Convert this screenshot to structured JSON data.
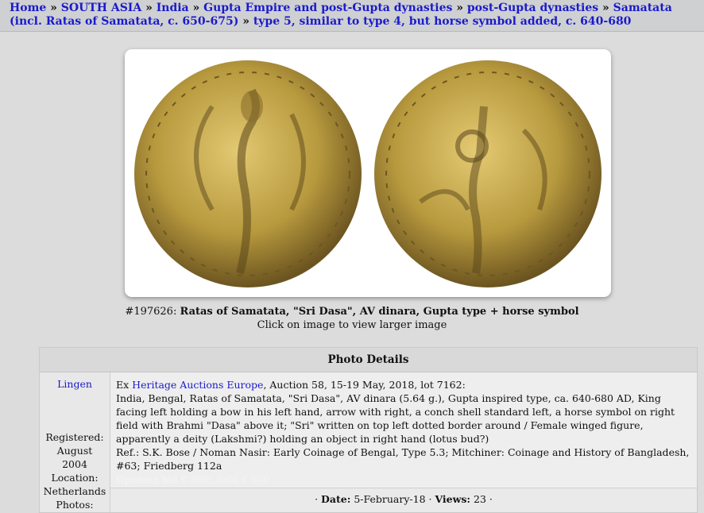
{
  "breadcrumb": {
    "items": [
      "Home",
      "SOUTH ASIA",
      "India",
      "Gupta Empire and post-Gupta dynasties",
      "post-Gupta dynasties",
      "Samatata (incl. Ratas of Samatata, c. 650-675)",
      "type 5, similar to type 4, but horse symbol added, c. 640-680"
    ],
    "separator": "»"
  },
  "photo": {
    "id_label": "#197626:",
    "title": "Ratas of Samatata, \"Sri Dasa\", AV dinara, Gupta type + horse symbol",
    "click_hint": "Click on image to view larger image"
  },
  "details": {
    "header": "Photo Details",
    "user": "Lingen",
    "registered_label": "Registered:",
    "registered_value_1": "August",
    "registered_value_2": "2004",
    "location_label": "Location:",
    "location_value": "Netherlands",
    "photos_label": "Photos:",
    "ex_prefix": "Ex",
    "ex_link": "Heritage Auctions Europe",
    "ex_suffix": ", Auction 58, 15-19 May, 2018, lot 7162:",
    "description": "India, Bengal, Ratas of Samatata, \"Sri Dasa\", AV dinara (5.64 g.), Gupta inspired type, ca. 640-680 AD, King facing left holding a bow in his left hand, arrow with right, a conch shell standard left, a horse symbol on right field with Brahmi \"Dasa\" above it; \"Sri\" written on top left dotted border around / Female winged figure, apparently a deity (Lakshmi?) holding an object in right hand (lotus bud?)",
    "references": "Ref.: S.K. Bose / Noman Nasir: Early Coinage of Bengal, Type 5.3; Mitchiner: Coinage and History of Bangladesh, #63; Friedberg 112a",
    "bid_text": "Opening bid € 300; Sold € 600",
    "date_label": "Date:",
    "date_value": "5-February-18",
    "views_label": "Views:",
    "views_value": "23"
  },
  "colors": {
    "link": "#1a1acc",
    "page_background": "#dcdcdc",
    "coin_gold": "#b89a3e"
  }
}
